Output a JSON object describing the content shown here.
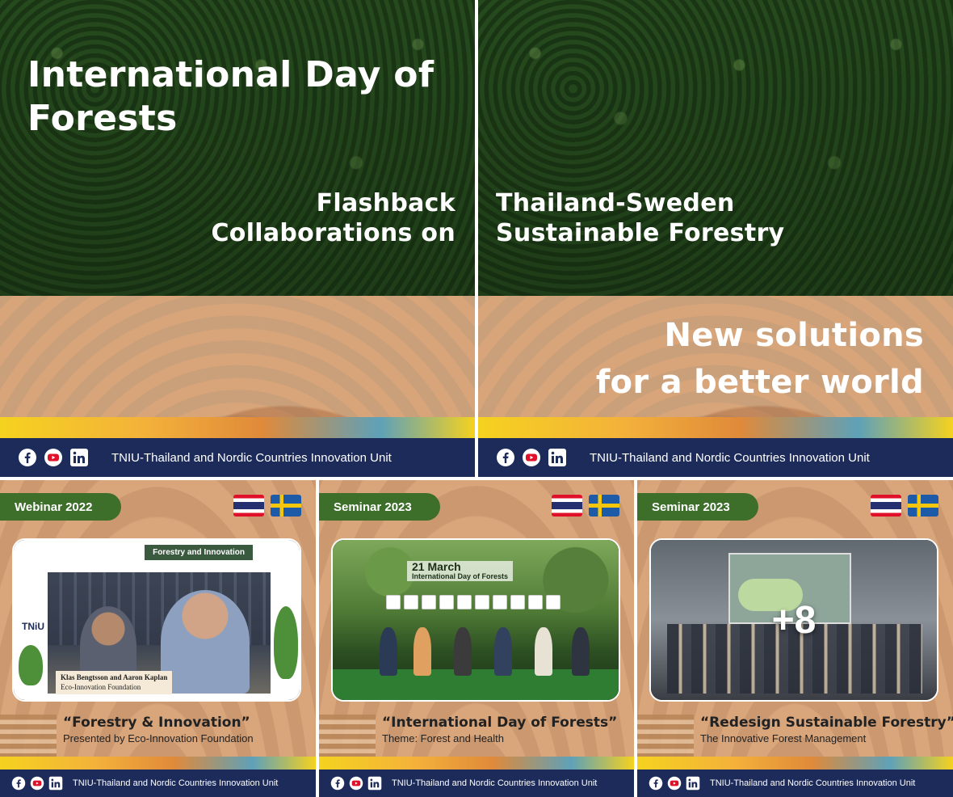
{
  "top_left": {
    "title": "International Day of Forests",
    "flashback_line1": "Flashback",
    "flashback_line2": "Collaborations on"
  },
  "top_right": {
    "subtitle_line1": "Thailand-Sweden",
    "subtitle_line2": "Sustainable Forestry",
    "tagline_line1": "New solutions",
    "tagline_line2": "for a better world"
  },
  "footer": {
    "org_name": "TNIU-Thailand and Nordic Countries Innovation Unit",
    "icons": [
      "facebook-icon",
      "youtube-icon",
      "linkedin-icon"
    ]
  },
  "cards": [
    {
      "badge": "Webinar 2022",
      "title": "“Forestry & Innovation”",
      "subtitle": "Presented by Eco-Innovation Foundation",
      "photo": {
        "banner": "Forestry and Innovation",
        "name_plate": "Klas Bengtsson and Aaron Kaplan",
        "org_plate": "Eco-Innovation Foundation",
        "logo": "TNiU"
      }
    },
    {
      "badge": "Seminar 2023",
      "title": "“International Day of Forests”",
      "subtitle": "Theme: Forest and Health",
      "photo": {
        "banner_date": "21 March",
        "banner_event": "International Day of Forests"
      }
    },
    {
      "badge": "Seminar 2023",
      "title": "“Redesign Sustainable Forestry”",
      "subtitle": "The Innovative Forest Management",
      "photo": {
        "more_count": "+8"
      }
    }
  ],
  "colors": {
    "footer_navy": "#1d2b5b",
    "badge_green": "#3d6e2a",
    "facebook_red": "#e0102a"
  }
}
